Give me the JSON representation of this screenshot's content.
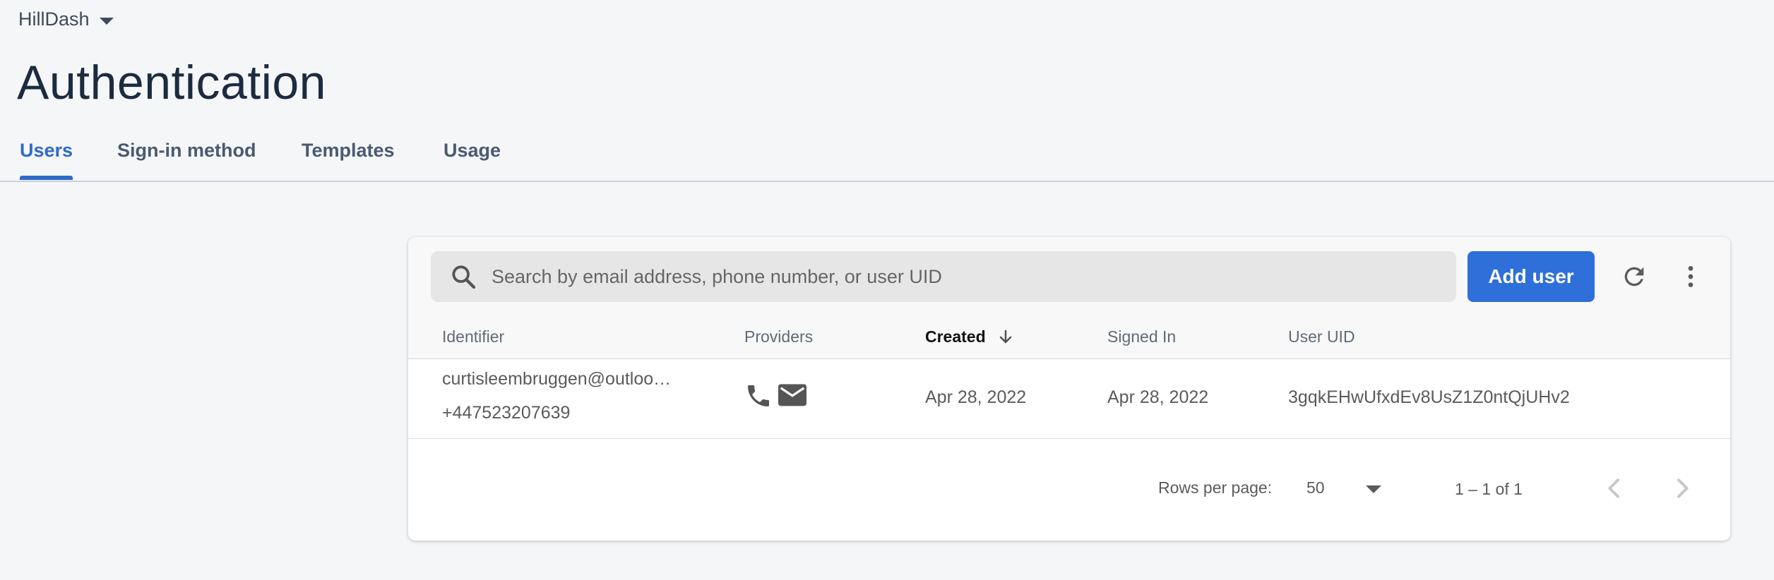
{
  "project": {
    "name": "HillDash"
  },
  "page": {
    "title": "Authentication"
  },
  "tabs": [
    {
      "label": "Users",
      "active": true
    },
    {
      "label": "Sign-in method",
      "active": false
    },
    {
      "label": "Templates",
      "active": false
    },
    {
      "label": "Usage",
      "active": false
    }
  ],
  "toolbar": {
    "search_placeholder": "Search by email address, phone number, or user UID",
    "add_user_label": "Add user"
  },
  "table": {
    "columns": [
      "Identifier",
      "Providers",
      "Created",
      "Signed In",
      "User UID"
    ],
    "sorted_column": "Created",
    "sort_direction": "descending",
    "rows": [
      {
        "identifier_email": "curtisleembruggen@outloo…",
        "identifier_phone": "+447523207639",
        "providers": [
          "phone-icon",
          "email-icon"
        ],
        "created": "Apr 28, 2022",
        "signed_in": "Apr 28, 2022",
        "user_uid": "3gqkEHwUfxdEv8UsZ1Z0ntQjUHv2"
      }
    ]
  },
  "pagination": {
    "rows_per_page_label": "Rows per page:",
    "rows_per_page_value": "50",
    "range_text": "1 – 1 of 1"
  },
  "colors": {
    "accent": "#2f6ac8",
    "button": "#2f6fd9",
    "background": "#f5f6f8"
  }
}
